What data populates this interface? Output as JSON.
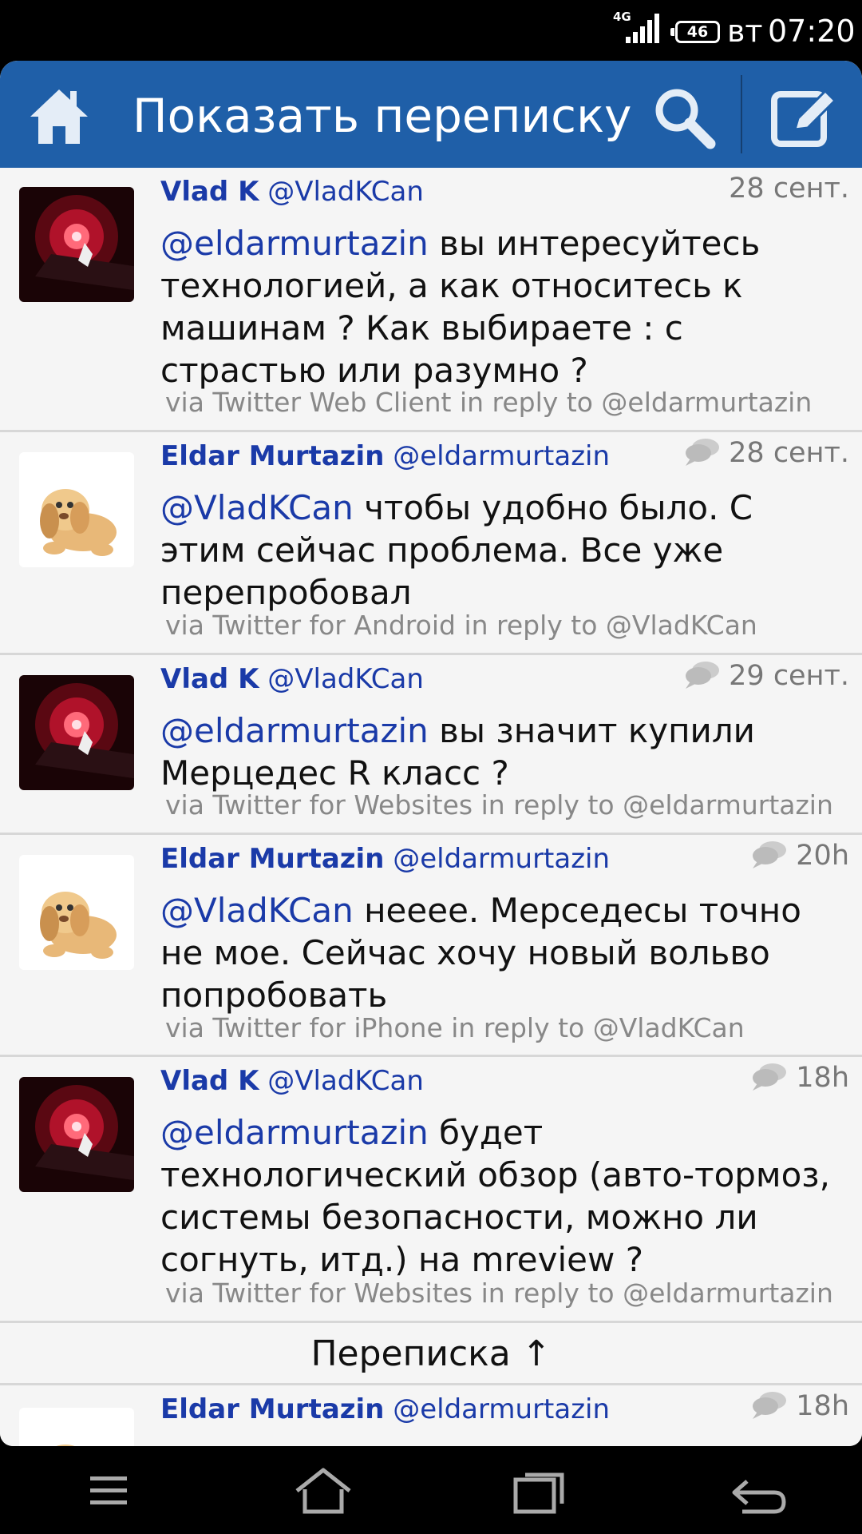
{
  "status_bar": {
    "network": "4G",
    "battery": "46",
    "day": "вт",
    "time": "07:20"
  },
  "action_bar": {
    "title": "Показать переписку",
    "icons": [
      "home-icon",
      "search-icon",
      "compose-icon"
    ],
    "color": "#1f5fa8"
  },
  "tweets": [
    {
      "name": "Vlad K",
      "handle": "@VladKCan",
      "time": "28 сент.",
      "mention": "@eldarmurtazin",
      "text": " вы интересуйтесь технологией, а как относитесь к машинам ?  Как выбираете : с страстью или разумно ?",
      "via": "via Twitter Web Client in reply to @eldarmurtazin",
      "avatar": "fireworks-avatar"
    },
    {
      "name": "Eldar Murtazin",
      "handle": "@eldarmurtazin",
      "time": "28 сент.",
      "mention": "@VladKCan",
      "text": " чтобы удобно было. С этим сейчас проблема. Все уже перепробовал",
      "via": "via Twitter for Android in reply to @VladKCan",
      "avatar": "plush-dog-avatar"
    },
    {
      "name": "Vlad K",
      "handle": "@VladKCan",
      "time": "29 сент.",
      "mention": "@eldarmurtazin",
      "text": " вы значит купили Мерцедес R класс ?",
      "via": "via Twitter for Websites in reply to @eldarmurtazin",
      "avatar": "fireworks-avatar"
    },
    {
      "name": "Eldar Murtazin",
      "handle": "@eldarmurtazin",
      "time": "20h",
      "mention": "@VladKCan",
      "text": " нееее. Мерседесы точно не мое. Сейчас хочу новый вольво попробовать",
      "via": "via Twitter for iPhone in reply to @VladKCan",
      "avatar": "plush-dog-avatar"
    },
    {
      "name": "Vlad K",
      "handle": "@VladKCan",
      "time": "18h",
      "mention": "@eldarmurtazin",
      "text": " будет технологический обзор (авто-тормоз, системы безопасности, можно ли согнуть, итд.) на mreview ?",
      "via": "via Twitter for Websites in reply to @eldarmurtazin",
      "avatar": "fireworks-avatar"
    }
  ],
  "conversation_bar": {
    "label": "Переписка ↑"
  },
  "last_tweet": {
    "name": "Eldar Murtazin",
    "handle": "@eldarmurtazin",
    "time": "18h",
    "avatar": "plush-dog-avatar"
  },
  "nav_bar": {
    "icons": [
      "menu-icon",
      "home-icon",
      "recents-icon",
      "back-icon"
    ]
  }
}
